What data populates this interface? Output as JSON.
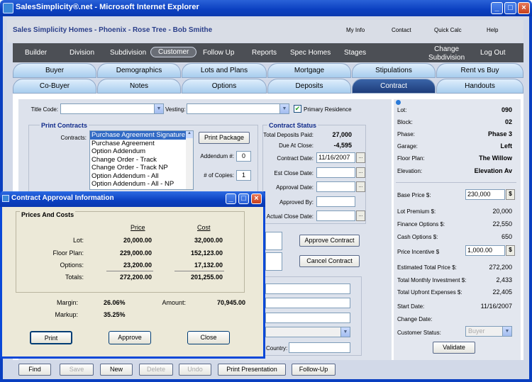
{
  "window": {
    "title": "SalesSimplicity®.net - Microsoft Internet Explorer"
  },
  "header": {
    "app_title": "Sales Simplicity Homes - Phoenix - Rose Tree - Bob Smithe",
    "links": [
      "My Info",
      "Contact",
      "Quick Calc",
      "Help"
    ]
  },
  "nav": {
    "items": [
      "Builder",
      "Division",
      "Subdivision",
      "Customer",
      "Follow Up",
      "Reports",
      "Spec Homes",
      "Stages"
    ],
    "selected": "Customer",
    "change_subdivision": [
      "Change",
      "Subdivision"
    ],
    "logout": "Log Out"
  },
  "tabs_row1": [
    "Buyer",
    "Demographics",
    "Lots and Plans",
    "Mortgage",
    "Stipulations",
    "Rent vs Buy"
  ],
  "tabs_row2": [
    "Co-Buyer",
    "Notes",
    "Options",
    "Deposits",
    "Contract",
    "Handouts"
  ],
  "tabs_selected": "Contract",
  "form": {
    "title_code_label": "Title Code:",
    "vesting_label": "Vesting:",
    "primary_residence_label": "Primary Residence",
    "primary_residence_checked": "✔",
    "print_contracts_title": "Print Contracts",
    "contracts_label": "Contracts:",
    "contracts_list": [
      "Purchase Agreement Signature",
      "Purchase Agreement",
      "Option Addendum",
      "Change Order - Track",
      "Change Order - Track NP",
      "Option Addendum - All",
      "Option Addendum - All - NP"
    ],
    "contracts_selected": "Purchase Agreement Signature",
    "print_package_button": "Print Package",
    "addendum_label": "Addendum #:",
    "addendum_value": "0",
    "copies_label": "# of Copies:",
    "copies_value": "1",
    "approve_contract_button": "Approve Contract",
    "cancel_contract_button": "Cancel Contract",
    "country_label": "Country:"
  },
  "contract_status": {
    "title": "Contract Status",
    "total_deposits_label": "Total Deposits Paid:",
    "total_deposits_value": "27,000",
    "due_at_close_label": "Due At Close:",
    "due_at_close_value": "-4,595",
    "contract_date_label": "Contract Date:",
    "contract_date_value": "11/16/2007",
    "est_close_label": "Est Close Date:",
    "approval_date_label": "Approval Date:",
    "approved_by_label": "Approved By:",
    "actual_close_label": "Actual Close Date:"
  },
  "summary": {
    "lot_label": "Lot:",
    "lot_value": "090",
    "block_label": "Block:",
    "block_value": "02",
    "phase_label": "Phase:",
    "phase_value": "Phase 3",
    "garage_label": "Garage:",
    "garage_value": "Left",
    "floor_plan_label": "Floor Plan:",
    "floor_plan_value": "The Willow",
    "elevation_label": "Elevation:",
    "elevation_value": "Elevation Av",
    "base_price_label": "Base Price $:",
    "base_price_value": "230,000",
    "lot_premium_label": "Lot Premium $:",
    "lot_premium_value": "20,000",
    "finance_options_label": "Finance Options $:",
    "finance_options_value": "22,550",
    "cash_options_label": "Cash Options $:",
    "cash_options_value": "650",
    "price_incentive_label": "Price Incentive $",
    "price_incentive_value": "1,000.00",
    "est_total_label": "Estimated Total Price $:",
    "est_total_value": "272,200",
    "monthly_label": "Total Monthly Investment $:",
    "monthly_value": "2,433",
    "upfront_label": "Total Upfront Expenses $:",
    "upfront_value": "22,405",
    "start_date_label": "Start Date:",
    "start_date_value": "11/16/2007",
    "change_date_label": "Change Date:",
    "customer_status_label": "Customer Status:",
    "customer_status_value": "Buyer",
    "validate_button": "Validate",
    "dollar_sign": "$"
  },
  "bottom_buttons": [
    "Find",
    "Save",
    "New",
    "Delete",
    "Undo",
    "Print Presentation",
    "Follow-Up"
  ],
  "dialog": {
    "title": "Contract Approval Information",
    "group_title": "Prices And Costs",
    "price_header": "Price",
    "cost_header": "Cost",
    "rows": [
      {
        "label": "Lot:",
        "price": "20,000.00",
        "cost": "32,000.00"
      },
      {
        "label": "Floor Plan:",
        "price": "229,000.00",
        "cost": "152,123.00"
      },
      {
        "label": "Options:",
        "price": "23,200.00",
        "cost": "17,132.00"
      },
      {
        "label": "Totals:",
        "price": "272,200.00",
        "cost": "201,255.00"
      }
    ],
    "margin_label": "Margin:",
    "margin_value": "26.06%",
    "markup_label": "Markup:",
    "markup_value": "35.25%",
    "amount_label": "Amount:",
    "amount_value": "70,945.00",
    "print_button": "Print",
    "approve_button": "Approve",
    "close_button": "Close"
  }
}
